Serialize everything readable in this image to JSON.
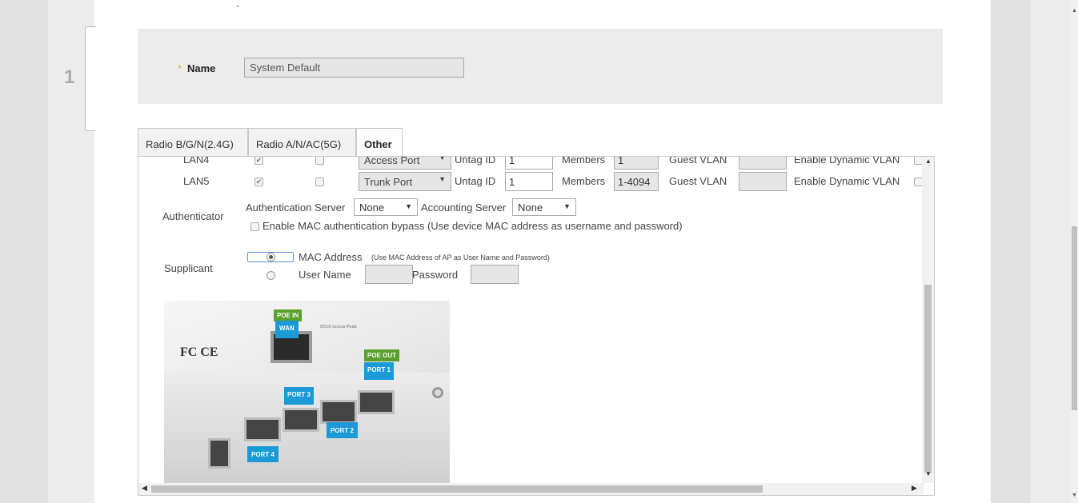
{
  "wizard": {
    "step_number": "1"
  },
  "form": {
    "required_marker": "*",
    "name_label": "Name",
    "name_value": "System Default"
  },
  "tabs": [
    {
      "label": "Radio B/G/N(2.4G)"
    },
    {
      "label": "Radio A/N/AC(5G)"
    },
    {
      "label": "Other",
      "active": true
    }
  ],
  "lan_rows": [
    {
      "name": "LAN4",
      "cb1_checked": true,
      "cb2_checked": false,
      "port_type": "Access Port",
      "untag_label": "Untag ID",
      "untag_id": "1",
      "members_label": "Members",
      "members": "1",
      "guest_vlan_label": "Guest VLAN",
      "guest_vlan": "",
      "dynamic_vlan_label": "Enable Dynamic VLAN"
    },
    {
      "name": "LAN5",
      "cb1_checked": true,
      "cb2_checked": false,
      "port_type": "Trunk Port",
      "untag_label": "Untag ID",
      "untag_id": "1",
      "members_label": "Members",
      "members": "1-4094",
      "guest_vlan_label": "Guest VLAN",
      "guest_vlan": "",
      "dynamic_vlan_label": "Enable Dynamic VLAN"
    }
  ],
  "authenticator": {
    "label": "Authenticator",
    "auth_server_label": "Authentication Server",
    "auth_server_value": "None",
    "acct_server_label": "Accounting Server",
    "acct_server_value": "None",
    "mac_bypass_label": "Enable MAC authentication bypass (Use device MAC address as username and password)"
  },
  "supplicant": {
    "label": "Supplicant",
    "mac_option_label": "MAC Address",
    "mac_option_hint": "(Use MAC Address of AP as User Name and Password)",
    "user_option_label": "User Name",
    "password_label": "Password",
    "selected": "mac"
  },
  "device_image": {
    "tags": {
      "poe_in": "POE IN",
      "wan": "WAN",
      "poe_out": "POE OUT",
      "port1": "PORT 1",
      "port2": "PORT 2",
      "port3": "PORT 3",
      "port4": "PORT 4"
    }
  },
  "icons": {
    "checkbox_checked": "check-mark",
    "dropdown": "caret-down-icon"
  },
  "colors": {
    "port_tag": "#1a9ad6",
    "poe_tag": "#5aa02c",
    "required": "#f0a030"
  }
}
